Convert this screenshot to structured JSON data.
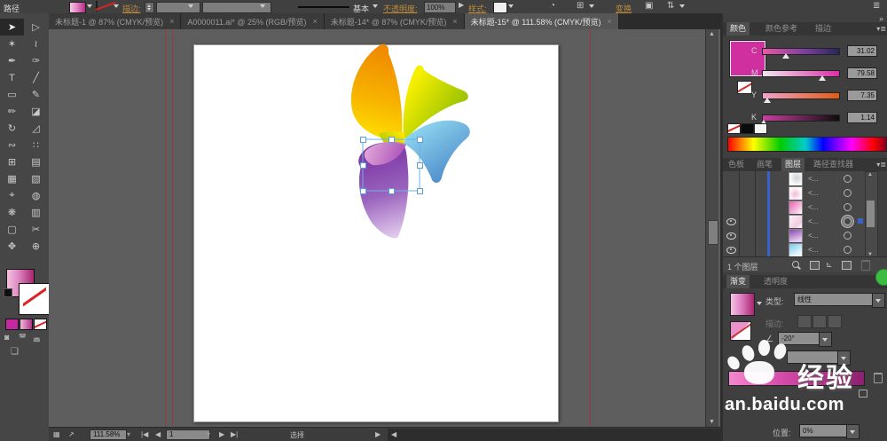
{
  "app": {
    "selection_type_label": "路径"
  },
  "control_bar": {
    "stroke_label": "描边:",
    "brush_style_value": "基本",
    "opacity_label": "不透明度:",
    "opacity_value": "100%",
    "style_label": "样式:",
    "transform_label": "变换"
  },
  "document_tabs": [
    {
      "title": "未标题-1 @ 87% (CMYK/预览)",
      "close": "×",
      "active": false
    },
    {
      "title": "A0000011.ai* @ 25% (RGB/预览)",
      "close": "×",
      "active": false
    },
    {
      "title": "未标题-14* @ 87% (CMYK/预览)",
      "close": "×",
      "active": false
    },
    {
      "title": "未标题-15* @ 111.58% (CMYK/预览)",
      "close": "×",
      "active": true
    }
  ],
  "tools": [
    {
      "name": "selection-tool",
      "glyph": "➤",
      "active": true
    },
    {
      "name": "direct-selection-tool",
      "glyph": "▷",
      "active": false
    },
    {
      "name": "magic-wand-tool",
      "glyph": "✶",
      "active": false
    },
    {
      "name": "lasso-tool",
      "glyph": "≀",
      "active": false
    },
    {
      "name": "pen-tool",
      "glyph": "✒",
      "active": false
    },
    {
      "name": "curvature-tool",
      "glyph": "✑",
      "active": false
    },
    {
      "name": "type-tool",
      "glyph": "T",
      "active": false
    },
    {
      "name": "line-segment-tool",
      "glyph": "╱",
      "active": false
    },
    {
      "name": "rectangle-tool",
      "glyph": "▭",
      "active": false
    },
    {
      "name": "paintbrush-tool",
      "glyph": "✎",
      "active": false
    },
    {
      "name": "pencil-tool",
      "glyph": "✏",
      "active": false
    },
    {
      "name": "eraser-tool",
      "glyph": "◪",
      "active": false
    },
    {
      "name": "rotate-tool",
      "glyph": "↻",
      "active": false
    },
    {
      "name": "scale-tool",
      "glyph": "◿",
      "active": false
    },
    {
      "name": "width-tool",
      "glyph": "∾",
      "active": false
    },
    {
      "name": "free-transform-tool",
      "glyph": "∷",
      "active": false
    },
    {
      "name": "shape-builder-tool",
      "glyph": "⊞",
      "active": false
    },
    {
      "name": "perspective-grid-tool",
      "glyph": "▤",
      "active": false
    },
    {
      "name": "mesh-tool",
      "glyph": "▦",
      "active": false
    },
    {
      "name": "gradient-tool",
      "glyph": "▧",
      "active": false
    },
    {
      "name": "eyedropper-tool",
      "glyph": "⌖",
      "active": false
    },
    {
      "name": "blend-tool",
      "glyph": "◍",
      "active": false
    },
    {
      "name": "symbol-sprayer-tool",
      "glyph": "❋",
      "active": false
    },
    {
      "name": "column-graph-tool",
      "glyph": "▥",
      "active": false
    },
    {
      "name": "artboard-tool",
      "glyph": "▢",
      "active": false
    },
    {
      "name": "slice-tool",
      "glyph": "✂",
      "active": false
    },
    {
      "name": "hand-tool",
      "glyph": "✥",
      "active": false
    },
    {
      "name": "zoom-tool",
      "glyph": "⊕",
      "active": false
    }
  ],
  "color_panel": {
    "tab_color": "颜色",
    "tab_color_guide": "颜色参考",
    "tab_stroke": "描边",
    "swatch_color": "#cf2f9f",
    "sliders": [
      {
        "channel": "C",
        "value": "31.02",
        "pos": 31
      },
      {
        "channel": "M",
        "value": "79.58",
        "pos": 79
      },
      {
        "channel": "Y",
        "value": "7.35",
        "pos": 7
      },
      {
        "channel": "K",
        "value": "1.14",
        "pos": 2
      }
    ]
  },
  "layers_panel": {
    "tab_swatches": "色板",
    "tab_brushes": "画笔",
    "tab_layers": "图层",
    "tab_pathfinder": "路径查找器",
    "rows": [
      {
        "label": "<...",
        "visible": false,
        "selected": false
      },
      {
        "label": "<...",
        "visible": false,
        "selected": false
      },
      {
        "label": "<...",
        "visible": false,
        "selected": false
      },
      {
        "label": "<...",
        "visible": true,
        "selected": true
      },
      {
        "label": "<...",
        "visible": true,
        "selected": false
      },
      {
        "label": "<...",
        "visible": true,
        "selected": false
      }
    ],
    "footer": "1 个图层"
  },
  "gradient_panel": {
    "tab_gradient": "渐变",
    "tab_transparency": "透明度",
    "type_label": "类型:",
    "type_value": "线性",
    "stroke_label": "描边:",
    "angle_value": "-20°",
    "position_label": "位置:",
    "position_value": "0%"
  },
  "status_bar": {
    "zoom_value": "111.58%",
    "artboard_number": "1",
    "tool_name": "选择"
  },
  "watermark": {
    "brand": "经验",
    "url": "an.baidu.com"
  },
  "canvas_art": {
    "description": "four-petal pinwheel flower",
    "petal_colors": {
      "orange": [
        "#f08c00",
        "#ffdf00"
      ],
      "yellow_green": [
        "#f7ef00",
        "#9cc400"
      ],
      "blue": [
        "#8fd8f0",
        "#4a86c8"
      ],
      "purple": [
        "#7a35a5",
        "#e4cdf0"
      ]
    }
  }
}
